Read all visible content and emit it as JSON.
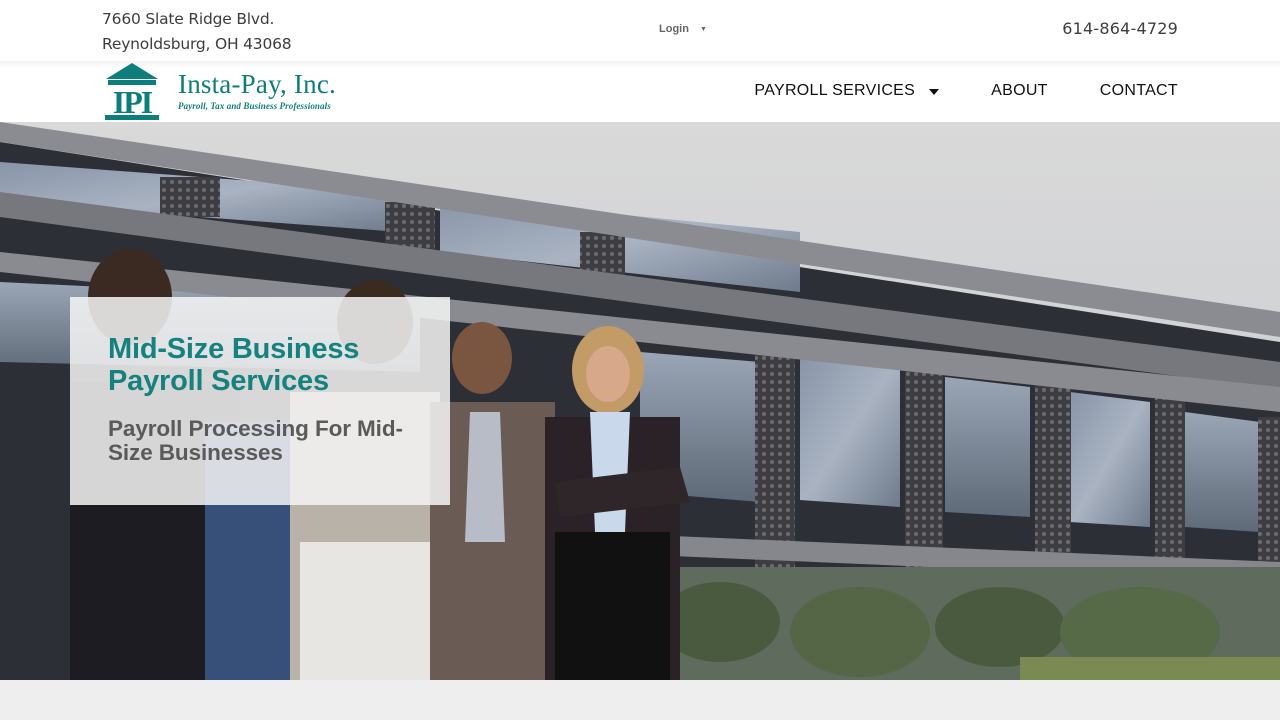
{
  "topbar": {
    "address_line1": "7660 Slate Ridge Blvd.",
    "address_line2": "Reynoldsburg, OH 43068",
    "login_label": "Login",
    "phone": "614-864-4729"
  },
  "logo": {
    "mark": "IPI",
    "name": "Insta-Pay, Inc.",
    "tagline": "Payroll, Tax and Business Professionals"
  },
  "nav": {
    "items": [
      {
        "label": "PAYROLL SERVICES",
        "has_dropdown": true
      },
      {
        "label": "ABOUT",
        "has_dropdown": false
      },
      {
        "label": "CONTACT",
        "has_dropdown": false
      }
    ]
  },
  "hero": {
    "title": "Mid-Size Business Payroll Services",
    "subtitle": "Payroll Processing For Mid-Size Businesses"
  },
  "colors": {
    "brand_teal": "#0d7e7b",
    "text_dark": "#111111",
    "subtitle_gray": "#5a5a5a"
  },
  "icons": {
    "login_caret": "caret-down-icon",
    "nav_caret": "caret-down-icon"
  }
}
